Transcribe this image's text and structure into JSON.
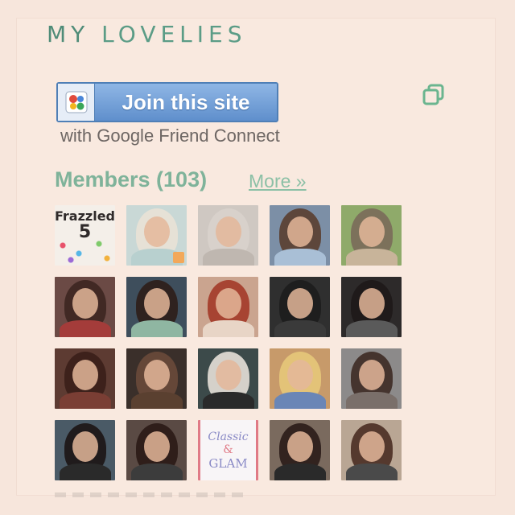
{
  "widget": {
    "title_my": "MY",
    "title_rest": "LOVELIES"
  },
  "join": {
    "button_label": "Join this site",
    "subtext": "with Google Friend Connect",
    "logo_icon": "google-friend-connect-icon",
    "corner_icon": "copy-icon"
  },
  "members": {
    "label": "Members (103)",
    "more_link": "More »",
    "tiles": [
      {
        "kind": "frazzled",
        "line1": "Frazzled",
        "line2": "5"
      },
      {
        "kind": "photo",
        "bg": "#c9d8d6",
        "hair": "#e9e2d6",
        "body": "#b8d0cf",
        "badge": true
      },
      {
        "kind": "photo",
        "bg": "#cfc8c2",
        "hair": "#d8d2cc",
        "body": "#bfb7b0"
      },
      {
        "kind": "photo",
        "bg": "#7c8fa6",
        "hair": "#5a3e30",
        "body": "#a9bfd6"
      },
      {
        "kind": "photo",
        "bg": "#8faa6a",
        "hair": "#7a6a5a",
        "body": "#c8b49a"
      },
      {
        "kind": "photo",
        "bg": "#6b4a45",
        "hair": "#3d2620",
        "body": "#a43c3a"
      },
      {
        "kind": "photo",
        "bg": "#3e4e5c",
        "hair": "#2e1e18",
        "body": "#8fb6a2"
      },
      {
        "kind": "photo",
        "bg": "#caa48f",
        "hair": "#a33a28",
        "body": "#e8d5c6"
      },
      {
        "kind": "photo",
        "bg": "#2f2f2f",
        "hair": "#1d1d1d",
        "body": "#3a3a3a"
      },
      {
        "kind": "photo",
        "bg": "#2d2a2a",
        "hair": "#1e1818",
        "body": "#5a5a5a"
      },
      {
        "kind": "photo",
        "bg": "#5d3b32",
        "hair": "#3a1f18",
        "body": "#7a3e34"
      },
      {
        "kind": "photo",
        "bg": "#3a2f2a",
        "hair": "#6a4a3a",
        "body": "#5a4030"
      },
      {
        "kind": "photo",
        "bg": "#3c4a4a",
        "hair": "#e5e0d8",
        "body": "#2a2a2a"
      },
      {
        "kind": "photo",
        "bg": "#c79a6a",
        "hair": "#e6c87a",
        "body": "#6a86b6"
      },
      {
        "kind": "photo",
        "bg": "#8c8a8a",
        "hair": "#3d2a24",
        "body": "#7a6f6a"
      },
      {
        "kind": "photo",
        "bg": "#4a5a66",
        "hair": "#1c1414",
        "body": "#2a2a2a"
      },
      {
        "kind": "photo",
        "bg": "#5a4a44",
        "hair": "#2a1a16",
        "body": "#3c3c3c"
      },
      {
        "kind": "glam",
        "line1": "Classic",
        "line2": "&",
        "line3": "GLAM"
      },
      {
        "kind": "photo",
        "bg": "#7a6a5e",
        "hair": "#2a1c18",
        "body": "#2a2a2a"
      },
      {
        "kind": "photo",
        "bg": "#b9a694",
        "hair": "#4a2e22",
        "body": "#4a4a4a"
      }
    ]
  },
  "colors": {
    "accent_green": "#7fb39a",
    "title_green": "#5b9c86",
    "button_blue": "#5f8fcc",
    "background": "#f7e6dc"
  }
}
